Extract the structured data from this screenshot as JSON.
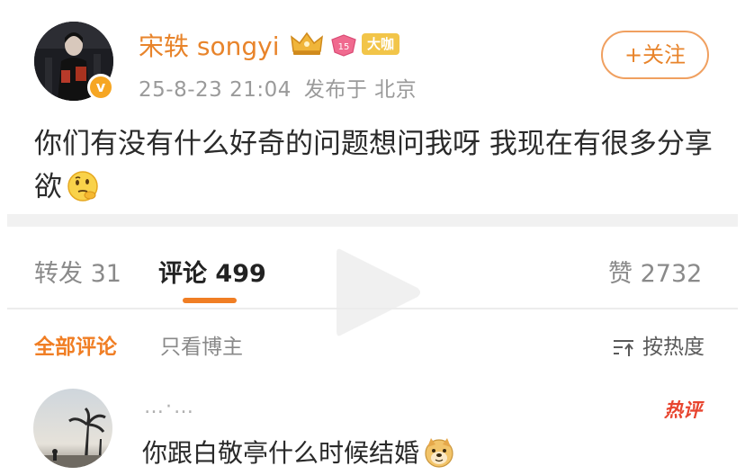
{
  "post": {
    "author": "宋轶 songyi",
    "vip_tag": "大咖",
    "level": "15",
    "verified_mark": "v",
    "date": "25-8-23 21:04",
    "published_from": "发布于 北京",
    "follow_label": "+关注",
    "text": "你们有没有什么好奇的问题想问我呀 我现在有很多分享欲",
    "text_emoji": "thinking-face-icon"
  },
  "stats": {
    "repost_label": "转发",
    "repost_count": "31",
    "comment_label": "评论",
    "comment_count": "499",
    "like_label": "赞",
    "like_count": "2732"
  },
  "filters": {
    "all_label": "全部评论",
    "author_only_label": "只看博主",
    "sort_label": "按热度"
  },
  "comment": {
    "username": "…·…",
    "hot_label": "热评",
    "text": "你跟白敬亭什么时候结婚",
    "text_emoji": "doge-icon"
  },
  "colors": {
    "accent": "#f07e24",
    "username": "#e8842b",
    "hot": "#e8452f"
  }
}
